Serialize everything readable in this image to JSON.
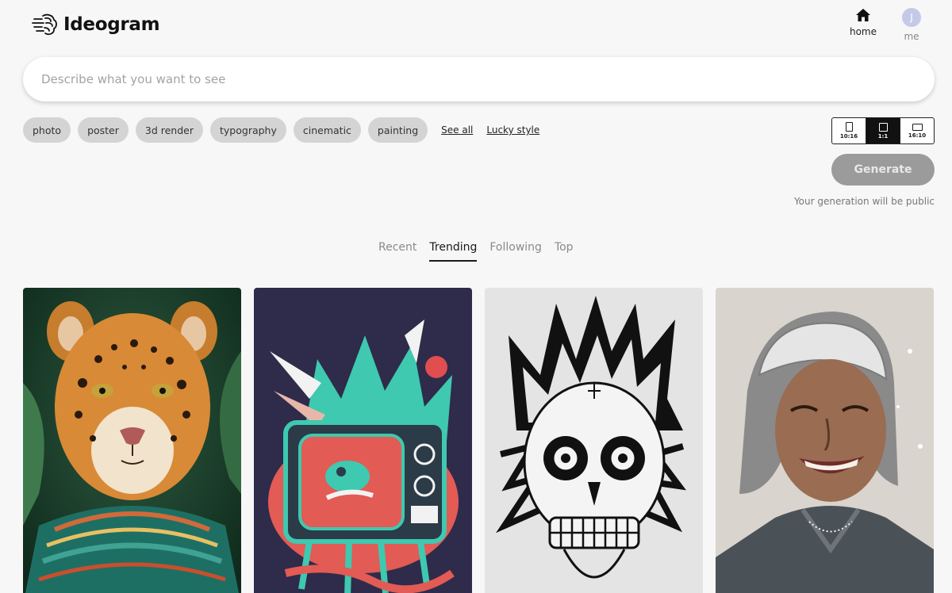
{
  "app": {
    "name": "Ideogram"
  },
  "nav": [
    {
      "label": "home",
      "icon": "home-icon"
    },
    {
      "label": "me",
      "avatar_letter": "J"
    }
  ],
  "prompt": {
    "placeholder": "Describe what you want to see",
    "value": ""
  },
  "style_chips": [
    "photo",
    "poster",
    "3d render",
    "typography",
    "cinematic",
    "painting"
  ],
  "links": {
    "see_all": "See all",
    "lucky_style": "Lucky style"
  },
  "aspect_ratios": [
    {
      "label": "10:16",
      "selected": false
    },
    {
      "label": "1:1",
      "selected": true
    },
    {
      "label": "16:10",
      "selected": false
    }
  ],
  "generate": {
    "label": "Generate",
    "note": "Your generation will be public"
  },
  "feed_tabs": [
    {
      "label": "Recent",
      "active": false
    },
    {
      "label": "Trending",
      "active": true
    },
    {
      "label": "Following",
      "active": false
    },
    {
      "label": "Top",
      "active": false
    }
  ],
  "gallery": [
    {
      "subject": "jaguar-portrait-image"
    },
    {
      "subject": "retro-tv-poster-image"
    },
    {
      "subject": "skull-ink-illustration-image"
    },
    {
      "subject": "smiling-woman-portrait-image"
    }
  ],
  "colors": {
    "chip_bg": "#d4d4d4",
    "generate_disabled": "#9b9b9b",
    "page_bg": "#f7f7f8",
    "accent": "#111111"
  }
}
